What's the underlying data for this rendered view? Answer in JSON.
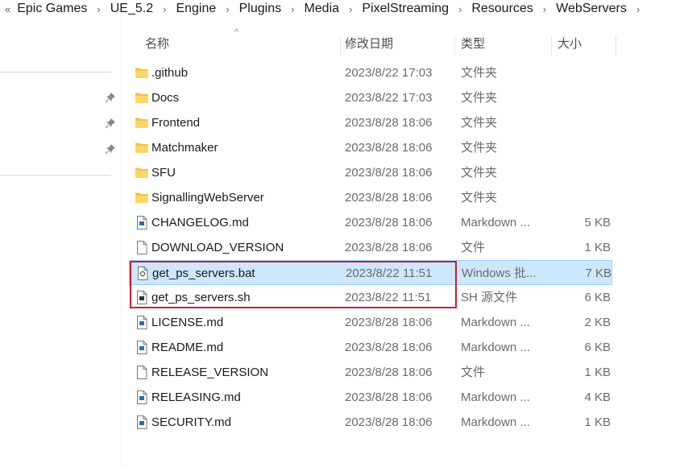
{
  "breadcrumb": {
    "overflow": "«",
    "items": [
      "Epic Games",
      "UE_5.2",
      "Engine",
      "Plugins",
      "Media",
      "PixelStreaming",
      "Resources",
      "WebServers"
    ],
    "separator": "›"
  },
  "columns": {
    "name": "名称",
    "date": "修改日期",
    "type": "类型",
    "size": "大小",
    "sort_indicator": "^"
  },
  "files": [
    {
      "name": ".github",
      "date": "2023/8/22 17:03",
      "type": "文件夹",
      "size": "",
      "icon": "folder-icon"
    },
    {
      "name": "Docs",
      "date": "2023/8/22 17:03",
      "type": "文件夹",
      "size": "",
      "icon": "folder-icon"
    },
    {
      "name": "Frontend",
      "date": "2023/8/28 18:06",
      "type": "文件夹",
      "size": "",
      "icon": "folder-icon"
    },
    {
      "name": "Matchmaker",
      "date": "2023/8/28 18:06",
      "type": "文件夹",
      "size": "",
      "icon": "folder-icon"
    },
    {
      "name": "SFU",
      "date": "2023/8/28 18:06",
      "type": "文件夹",
      "size": "",
      "icon": "folder-icon"
    },
    {
      "name": "SignallingWebServer",
      "date": "2023/8/28 18:06",
      "type": "文件夹",
      "size": "",
      "icon": "folder-icon"
    },
    {
      "name": "CHANGELOG.md",
      "date": "2023/8/28 18:06",
      "type": "Markdown ...",
      "size": "5 KB",
      "icon": "markdown-file-icon"
    },
    {
      "name": "DOWNLOAD_VERSION",
      "date": "2023/8/28 18:06",
      "type": "文件",
      "size": "1 KB",
      "icon": "file-icon"
    },
    {
      "name": "get_ps_servers.bat",
      "date": "2023/8/22 11:51",
      "type": "Windows 批...",
      "size": "7 KB",
      "icon": "batch-file-icon",
      "selected": true
    },
    {
      "name": "get_ps_servers.sh",
      "date": "2023/8/22 11:51",
      "type": "SH 源文件",
      "size": "6 KB",
      "icon": "shell-file-icon"
    },
    {
      "name": "LICENSE.md",
      "date": "2023/8/28 18:06",
      "type": "Markdown ...",
      "size": "2 KB",
      "icon": "markdown-file-icon"
    },
    {
      "name": "README.md",
      "date": "2023/8/28 18:06",
      "type": "Markdown ...",
      "size": "6 KB",
      "icon": "markdown-file-icon"
    },
    {
      "name": "RELEASE_VERSION",
      "date": "2023/8/28 18:06",
      "type": "文件",
      "size": "1 KB",
      "icon": "file-icon"
    },
    {
      "name": "RELEASING.md",
      "date": "2023/8/28 18:06",
      "type": "Markdown ...",
      "size": "4 KB",
      "icon": "markdown-file-icon"
    },
    {
      "name": "SECURITY.md",
      "date": "2023/8/28 18:06",
      "type": "Markdown ...",
      "size": "1 KB",
      "icon": "markdown-file-icon"
    }
  ],
  "colors": {
    "selection_bg": "#cce8ff",
    "selection_border": "#99d1ff",
    "highlight_box": "#c8202d",
    "folder": "#f5c242"
  }
}
